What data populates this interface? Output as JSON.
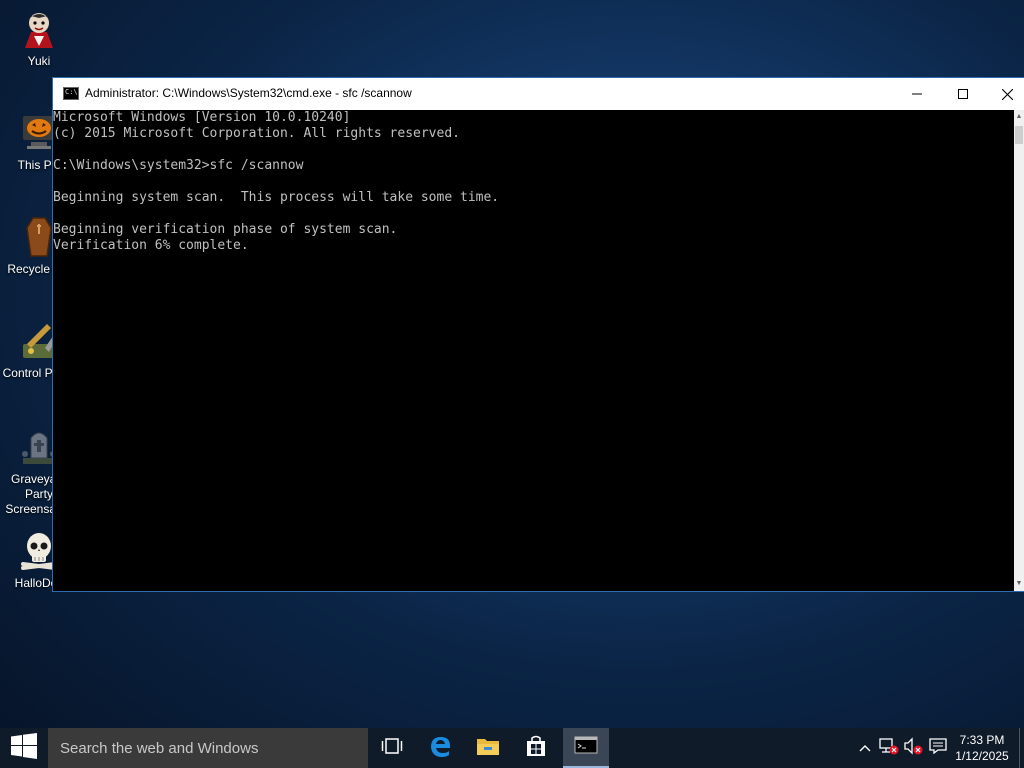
{
  "desktop": {
    "icons": [
      {
        "label": "Yuki",
        "icon": "vampire-avatar-icon"
      },
      {
        "label": "This PC",
        "icon": "pumpkin-computer-icon"
      },
      {
        "label": "Recycle Bin",
        "icon": "coffin-icon"
      },
      {
        "label": "Control Panel",
        "icon": "tools-icon"
      },
      {
        "label": "Graveyard\nParty Screensaver",
        "icon": "graveyard-icon"
      },
      {
        "label": "HalloDoc",
        "icon": "skull-icon"
      }
    ]
  },
  "window": {
    "title": "Administrator: C:\\Windows\\System32\\cmd.exe - sfc  /scannow",
    "icon_text": "C:\\",
    "controls": {
      "minimize": "minimize-icon",
      "maximize": "maximize-icon",
      "close": "close-icon"
    }
  },
  "console": {
    "lines": [
      "Microsoft Windows [Version 10.0.10240]",
      "(c) 2015 Microsoft Corporation. All rights reserved.",
      "",
      "C:\\Windows\\system32>sfc /scannow",
      "",
      "Beginning system scan.  This process will take some time.",
      "",
      "Beginning verification phase of system scan.",
      "Verification 6% complete."
    ]
  },
  "taskbar": {
    "search_placeholder": "Search the web and Windows",
    "apps": [
      {
        "name": "task-view",
        "icon": "task-view-icon"
      },
      {
        "name": "edge",
        "icon": "edge-icon"
      },
      {
        "name": "file-explorer",
        "icon": "folder-icon"
      },
      {
        "name": "store",
        "icon": "store-icon"
      },
      {
        "name": "command-prompt",
        "icon": "cmd-icon",
        "active": true
      }
    ],
    "tray": [
      "chevron-up-icon",
      "network-error-icon",
      "volume-muted-icon",
      "notifications-icon"
    ],
    "time": "7:33 PM",
    "date": "1/12/2025"
  },
  "colors": {
    "console_bg": "#000000",
    "console_text": "#c0c0c0",
    "taskbar_bg": "#101b29",
    "search_bg": "#3a3a3a",
    "accent": "#9ab8de"
  }
}
